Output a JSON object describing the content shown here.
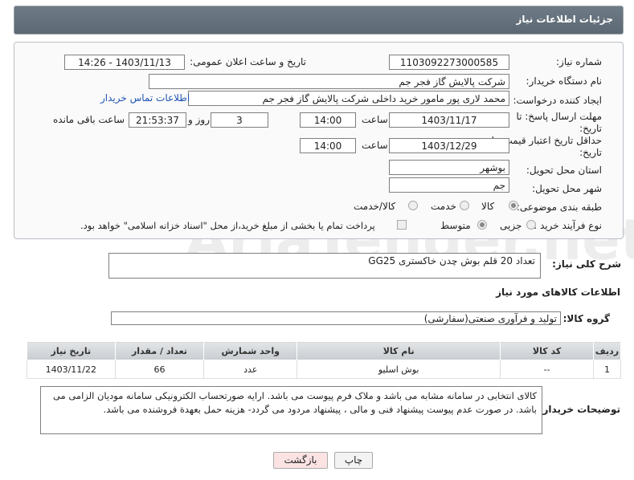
{
  "header": {
    "title": "جزئیات اطلاعات نیاز"
  },
  "form": {
    "need_number_label": "شماره نیاز:",
    "need_number": "1103092273000585",
    "announce_label": "تاریخ و ساعت اعلان عمومی:",
    "announce_value": "1403/11/13 - 14:26",
    "buyer_org_label": "نام دستگاه خریدار:",
    "buyer_org": "شرکت پالایش گاز فجر جم",
    "creator_label": "ایجاد کننده درخواست:",
    "creator": "محمد  لاری پور مامور خرید داخلی شرکت پالایش گاز فجر جم",
    "contact_link": "اطلاعات تماس خریدار",
    "reply_deadline_label_1": "مهلت ارسال پاسخ: تا",
    "reply_deadline_label_2": "تاریخ:",
    "reply_date": "1403/11/17",
    "time_label": "ساعت",
    "reply_time": "14:00",
    "days_value": "3",
    "days_label": "روز و",
    "remaining_time": "21:53:37",
    "remaining_label": "ساعت باقی مانده",
    "price_validity_label_1": "حداقل تاریخ اعتبار قیمت: تا",
    "price_validity_label_2": "تاریخ:",
    "price_date": "1403/12/29",
    "price_time": "14:00",
    "province_label": "استان محل تحویل:",
    "province": "بوشهر",
    "city_label": "شهر محل تحویل:",
    "city": "جم",
    "category_label": "طبقه بندی موضوعی:",
    "category_options": [
      "کالا",
      "خدمت",
      "کالا/خدمت"
    ],
    "purchase_type_label": "نوع فرآیند خرید :",
    "purchase_options": [
      "جزیی",
      "متوسط"
    ],
    "payment_note": "پرداخت تمام یا بخشی از مبلغ خرید،از محل \"اسناد خزانه اسلامی\" خواهد بود."
  },
  "summary": {
    "label": "شرح کلی نیاز:",
    "text": "تعداد 20 قلم بوش چدن خاکستری GG25"
  },
  "goods": {
    "section_title": "اطلاعات کالاهای مورد نیاز",
    "group_label": "گروه کالا:",
    "group_value": "تولید و فرآوری صنعتی(سفارشی)",
    "columns": [
      "ردیف",
      "کد کالا",
      "نام کالا",
      "واحد شمارش",
      "تعداد / مقدار",
      "تاریخ نیاز"
    ],
    "rows": [
      {
        "row": "1",
        "code": "--",
        "name": "بوش اسلیو",
        "unit": "عدد",
        "qty": "66",
        "date": "1403/11/22"
      }
    ]
  },
  "buyer_notes": {
    "label": "توضیحات خریدار:",
    "text": "کالای انتخابی در سامانه مشابه می باشد و ملاک فرم پیوست می باشد.  ارایه صورتحساب الکترونیکی سامانه مودیان الزامی می باشد. در صورت عدم پیوست پیشنهاد فنی و مالی ، پیشنهاد مردود می گردد- هزینه حمل بعهدة فروشنده می باشد."
  },
  "buttons": {
    "print": "چاپ",
    "back": "بازگشت"
  },
  "watermark": "AriaTender.net",
  "colors": {
    "header_bg": "#5c6873",
    "link": "#1f55b5",
    "back_button_bg": "#fbe3e3"
  }
}
